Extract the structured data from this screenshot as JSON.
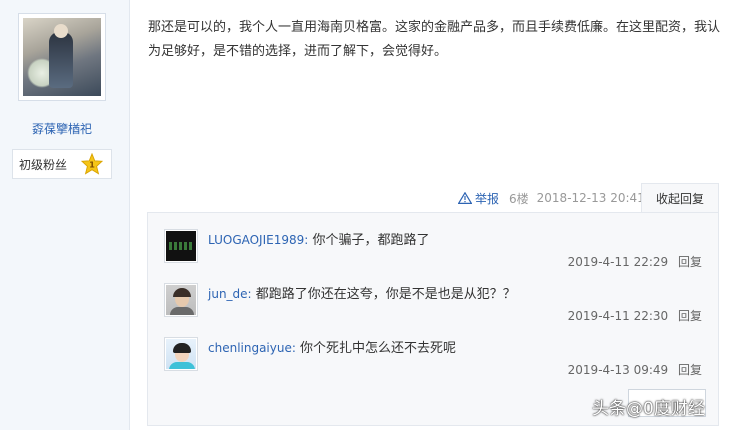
{
  "user": {
    "name": "孬葆擥楢祀",
    "rank_label": "初级粉丝",
    "level": "1"
  },
  "post": {
    "text": "那还是可以的，我个人一直用海南贝格富。这家的金融产品多，而且手续费低廉。在这里配资，我认为足够好，是不错的选择，进而了解下，会觉得好。",
    "report_label": "举报",
    "floor": "6楼",
    "timestamp": "2018-12-13 20:41",
    "collapse_label": "收起回复"
  },
  "replies": [
    {
      "name": "LUOGAOJIE1989",
      "separator": ":",
      "text": "你个骗子，都跑路了",
      "time": "2019-4-11 22:29",
      "reply_label": "回复"
    },
    {
      "name": "jun_de",
      "separator": ":",
      "text": "都跑路了你还在这夸，你是不是也是从犯？？",
      "time": "2019-4-11 22:30",
      "reply_label": "回复"
    },
    {
      "name": "chenlingaiyue",
      "separator": ":",
      "text": "你个死扎中怎么还不去死呢",
      "time": "2019-4-13 09:49",
      "reply_label": "回复"
    }
  ],
  "watermark": {
    "prefix": "头条",
    "handle": "@0度财经"
  },
  "colors": {
    "link_blue": "#2d64b3",
    "level_star": "#f5c518",
    "sidebar_bg": "#f3f7fb",
    "reply_bg": "#f7f8fa"
  }
}
